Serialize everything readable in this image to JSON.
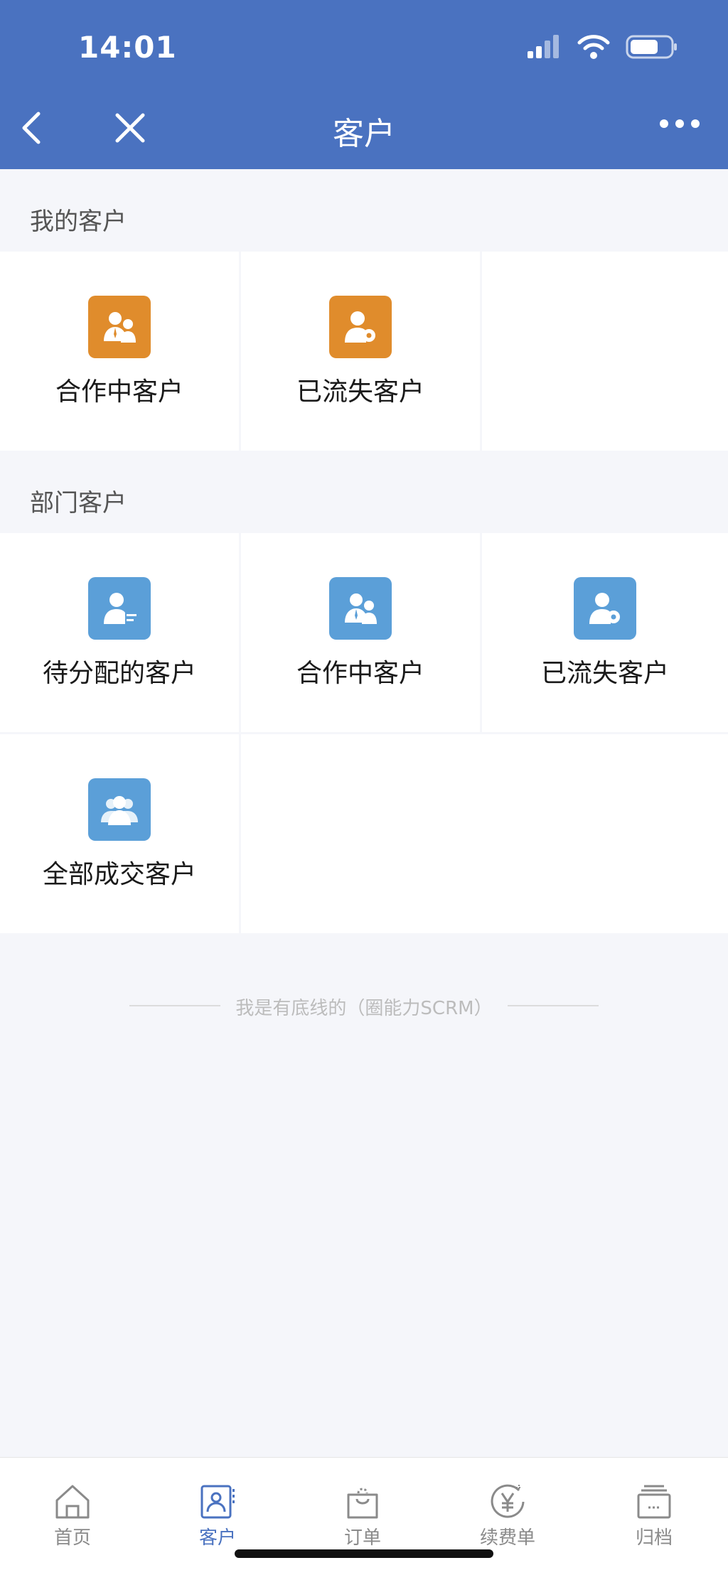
{
  "status": {
    "time": "14:01"
  },
  "nav": {
    "title": "客户"
  },
  "my_section": {
    "title": "我的客户",
    "items": [
      {
        "label": "合作中客户",
        "icon": "customers-cooperating-icon",
        "color": "#e08c2c"
      },
      {
        "label": "已流失客户",
        "icon": "customer-lost-icon",
        "color": "#e08c2c"
      }
    ]
  },
  "dept_section": {
    "title": "部门客户",
    "items": [
      {
        "label": "待分配的客户",
        "icon": "customer-pending-icon",
        "color": "#5b9fd8"
      },
      {
        "label": "合作中客户",
        "icon": "customers-cooperating-icon",
        "color": "#5b9fd8"
      },
      {
        "label": "已流失客户",
        "icon": "customer-lost-icon",
        "color": "#5b9fd8"
      },
      {
        "label": "全部成交客户",
        "icon": "all-customers-icon",
        "color": "#5b9fd8"
      }
    ]
  },
  "footer": {
    "text": "我是有底线的（圈能力SCRM）"
  },
  "tabbar": {
    "active": "客户",
    "items": [
      {
        "label": "首页",
        "icon": "home-icon"
      },
      {
        "label": "客户",
        "icon": "contacts-icon"
      },
      {
        "label": "订单",
        "icon": "shopping-bag-icon"
      },
      {
        "label": "续费单",
        "icon": "yen-renew-icon"
      },
      {
        "label": "归档",
        "icon": "archive-icon"
      }
    ]
  },
  "colors": {
    "header": "#4a72c0",
    "accent_orange": "#e08c2c",
    "accent_blue": "#5b9fd8",
    "background": "#f5f6fa"
  }
}
